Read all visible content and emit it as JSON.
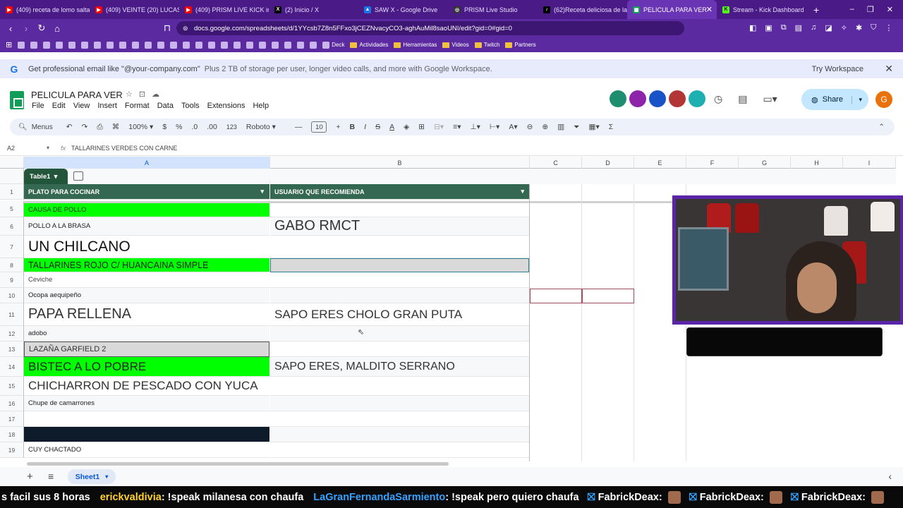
{
  "browser": {
    "tabs": [
      {
        "title": "(409) receta de lomo salta",
        "color": "#ff0000"
      },
      {
        "title": "(409) VEINTE (20) LUCAS",
        "color": "#ff0000"
      },
      {
        "title": "(409) PRISM LIVE KICK ir",
        "color": "#ff0000"
      },
      {
        "title": "(2) Inicio / X",
        "color": "#000000"
      },
      {
        "title": "SAW X - Google Drive",
        "color": "#1a73e8"
      },
      {
        "title": "PRISM Live Studio",
        "color": "#333333"
      },
      {
        "title": "(62)Receta deliciosa de la",
        "color": "#000000"
      },
      {
        "title": "PELICULA PARA VER",
        "color": "#0f9d58"
      },
      {
        "title": "Stream - Kick Dashboard",
        "color": "#53fc18"
      }
    ],
    "new_tab": "+",
    "win_min": "–",
    "win_max": "❐",
    "win_close": "✕",
    "url": "docs.google.com/spreadsheets/d/1YYcsb7Z8n5FFxo3jCEZNvacyCO3-aghAuMil8saoUNI/edit?gid=0#gid=0",
    "bookmarks": [
      "Deck",
      "Actividades",
      "Herramientas",
      "Videos",
      "Twitch",
      "Partners"
    ]
  },
  "promo": {
    "text": "Get professional email like \"@your-company.com\"",
    "subtext": "Plus 2 TB of storage per user, longer video calls, and more with Google Workspace.",
    "cta": "Try Workspace"
  },
  "doc": {
    "title": "PELICULA PARA VER",
    "menus": [
      "File",
      "Edit",
      "View",
      "Insert",
      "Format",
      "Data",
      "Tools",
      "Extensions",
      "Help"
    ],
    "share": "Share",
    "avatar_letter": "G"
  },
  "toolbar": {
    "menus": "Menus",
    "zoom": "100%",
    "currency": "$",
    "percent": "%",
    "dec_less": ".0",
    "dec_more": ".00",
    "number_format": "123",
    "font": "Roboto",
    "font_size": "10"
  },
  "formula": {
    "cell_ref": "A2",
    "fx": "fx",
    "value": "TALLARINES VERDES CON CARNE"
  },
  "grid": {
    "columns": [
      "A",
      "B",
      "C",
      "D",
      "E",
      "F",
      "G",
      "H",
      "I"
    ],
    "table_name": "Table1",
    "headers": [
      "PLATO PARA COCINAR",
      "USUARIO QUE RECOMIENDA"
    ],
    "rows": [
      {
        "num": "1",
        "a": "",
        "b": ""
      },
      {
        "num": "5",
        "a": "CAUSA DE POLLO",
        "b": ""
      },
      {
        "num": "6",
        "a": "POLLO A LA BRASA",
        "b": "GABO RMCT"
      },
      {
        "num": "7",
        "a": "UN CHILCANO",
        "b": ""
      },
      {
        "num": "8",
        "a": "TALLARINES ROJO C/ HUANCAINA SIMPLE",
        "b": ""
      },
      {
        "num": "9",
        "a": "Ceviche",
        "b": ""
      },
      {
        "num": "10",
        "a": "Ocopa aequipeño",
        "b": ""
      },
      {
        "num": "11",
        "a": "PAPA RELLENA",
        "b": "SAPO ERES CHOLO GRAN PUTA"
      },
      {
        "num": "12",
        "a": "adobo",
        "b": ""
      },
      {
        "num": "13",
        "a": "LAZAÑA GARFIELD 2",
        "b": ""
      },
      {
        "num": "14",
        "a": "BISTEC A LO POBRE",
        "b": "SAPO ERES, MALDITO SERRANO"
      },
      {
        "num": "15",
        "a": "CHICHARRON DE PESCADO CON YUCA",
        "b": ""
      },
      {
        "num": "16",
        "a": "Chupe de camarrones",
        "b": ""
      },
      {
        "num": "17",
        "a": "",
        "b": ""
      },
      {
        "num": "18",
        "a": "",
        "b": ""
      },
      {
        "num": "19",
        "a": "CUY CHACTADO",
        "b": ""
      }
    ]
  },
  "sheets": {
    "active": "Sheet1",
    "add": "+",
    "list": "≡"
  },
  "ticker": {
    "segments": [
      {
        "user": "",
        "msg": "s facil sus 8 horas"
      },
      {
        "user": "erickvaldivia",
        "msg": " : !speak milanesa con chaufa"
      },
      {
        "user": "LaGranFernandaSarmiento",
        "msg": " : !speak pero quiero chaufa"
      },
      {
        "user": "FabrickDeax",
        "msg": " : "
      },
      {
        "user": "FabrickDeax",
        "msg": " : "
      },
      {
        "user": "FabrickDeax",
        "msg": " : "
      }
    ]
  },
  "colors": {
    "table_header": "#356853",
    "highlight_green": "#00ff00",
    "browser_purple": "#4a1b86"
  }
}
